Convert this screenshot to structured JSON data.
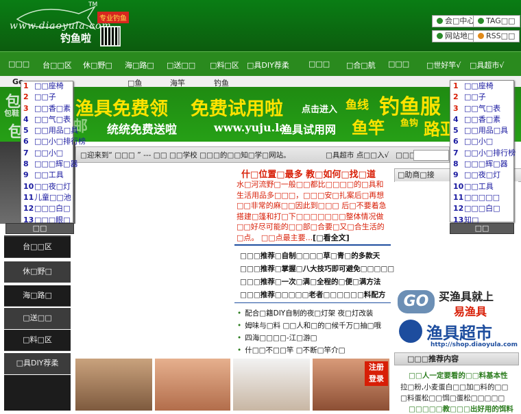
{
  "header": {
    "logo_url": "www.diaoyula.com",
    "logo_tm": "TM",
    "logo_tag": "专业钓鱼",
    "logo_name": "钓鱼啦",
    "buttons": [
      "会□中心",
      "TAG□□",
      "网站地□",
      "RSS□□"
    ]
  },
  "mainnav": {
    "items": [
      "□□□",
      "台□□区",
      "休□野□",
      "海□路□",
      "□送□□",
      "□料□区",
      "□具DIY荐柔",
      "□□□",
      "□合□航",
      "□□□",
      "□世好竿√",
      "□具超市√"
    ]
  },
  "subnav": {
    "first": "Go",
    "items": [
      "□鱼",
      "海竿",
      "钓鱼"
    ]
  },
  "banner": {
    "line1a": "渔具免费领",
    "line1b": "免费试用啦",
    "click": "点击进入",
    "line2": "统统免费送啦",
    "site": "www.yuju.la",
    "site_name": "渔具试用网",
    "p1": "鱼线",
    "p2": "钓鱼服",
    "p3": "鱼竿",
    "p4": "鱼钩",
    "p5": "路亚",
    "edge_left": "包",
    "edge_left2": "包鞋",
    "edge_left3": "邮"
  },
  "left_dropdown": {
    "items": [
      {
        "n": "1",
        "t": "□□座椅",
        "c": "red"
      },
      {
        "n": "2",
        "t": "□□子",
        "c": "red"
      },
      {
        "n": "3",
        "t": "□□香□素",
        "c": "red"
      },
      {
        "n": "4",
        "t": "□□气□表",
        "c": "blue"
      },
      {
        "n": "5",
        "t": "□□用品□具",
        "c": "blue"
      },
      {
        "n": "6",
        "t": "□□小□排行榜",
        "c": "blue"
      },
      {
        "n": "7",
        "t": "□□小□",
        "c": "blue"
      },
      {
        "n": "8",
        "t": "□□□辉□器",
        "c": "blue"
      },
      {
        "n": "9",
        "t": "□□工具",
        "c": "blue"
      },
      {
        "n": "10",
        "t": "□□夜□灯",
        "c": "blue"
      },
      {
        "n": "11",
        "t": "儿童□□池",
        "c": "blue"
      },
      {
        "n": "12",
        "t": "□□□白□",
        "c": "blue"
      },
      {
        "n": "13",
        "t": "□□□眼□",
        "c": "blue"
      }
    ],
    "button": "□□"
  },
  "right_dropdown": {
    "items": [
      {
        "n": "1",
        "t": "□□座椅",
        "c": "red"
      },
      {
        "n": "2",
        "t": "□□子",
        "c": "red"
      },
      {
        "n": "3",
        "t": "□□气□表",
        "c": "red"
      },
      {
        "n": "4",
        "t": "□□香□素",
        "c": "blue"
      },
      {
        "n": "5",
        "t": "□□用品□具",
        "c": "blue"
      },
      {
        "n": "6",
        "t": "□□小□",
        "c": "blue"
      },
      {
        "n": "7",
        "t": "□□小□排行榜",
        "c": "blue"
      },
      {
        "n": "8",
        "t": "□□□辉□器",
        "c": "blue"
      },
      {
        "n": "9",
        "t": "□□夜□灯",
        "c": "blue"
      },
      {
        "n": "10",
        "t": "□□工具",
        "c": "blue"
      },
      {
        "n": "11",
        "t": "□□□□□",
        "c": "blue"
      },
      {
        "n": "12",
        "t": "□□□白□",
        "c": "blue"
      },
      {
        "n": "13",
        "t": "知□",
        "c": "blue"
      }
    ],
    "button": "□□"
  },
  "left_sidebar": [
    "□□□□",
    "台□□区",
    "休□野□",
    "海□路□",
    "□送□□",
    "□料□区",
    "□具DIY荐柔"
  ],
  "welcome": {
    "text": "□迎来到“ □□□ ” --- □□ □□学校 □□□的□□知□学□网站。",
    "link": "□具超市 点□□入√",
    "link2": "□□□□网"
  },
  "headline": "什□位置□最多 教□如何□找□道",
  "lead": "水□河流野□一般□□都比□□□□的□具和生活用品多□□□，□□□安□扎案后□再想□□非常的麻□□因此到□□□ 后□不要着急搭建□篷和打□下□□□□□□□整体情况做□□好尽可能的□□部□合要□又□合生活的□点。 □□点最主要...",
  "lead_more": "[□看全文]",
  "news": [
    "□□□推荐□自制□□□□草□青□的多款天",
    "□□□推荐□掌握□八大技巧即可避免□□□□□",
    "□□□推荐□一次□满□全程的□便□满方法",
    "□□□推荐□□□□□老者□□□□□□料配方"
  ],
  "bullets": [
    "配合□籍DIY自制的夜□灯架 夜□灯改装",
    "姆味与□料 □□人和□的□候千万□抽□哦",
    "四海□□□□-江□游□",
    "什□□不□□竿 □不断□竿介□"
  ],
  "help_head": "□助商□接",
  "ads": {
    "ad1_top": "买渔具就上",
    "ad1_brand": "易渔具",
    "ad2": "渔具超市",
    "ad2_url": "http://shop.diaoyula.com"
  },
  "rec_head": "□□□推荐内容",
  "rec_items": [
    "□□人一定要看的□□料基本性",
    "拉□粉,小麦蛋白□□加□料的□□",
    "□料蛋松□□饵□蛋松□□□□□",
    "□□□□□教□□□出好用的饵料"
  ],
  "register": [
    "注册",
    "登录"
  ]
}
